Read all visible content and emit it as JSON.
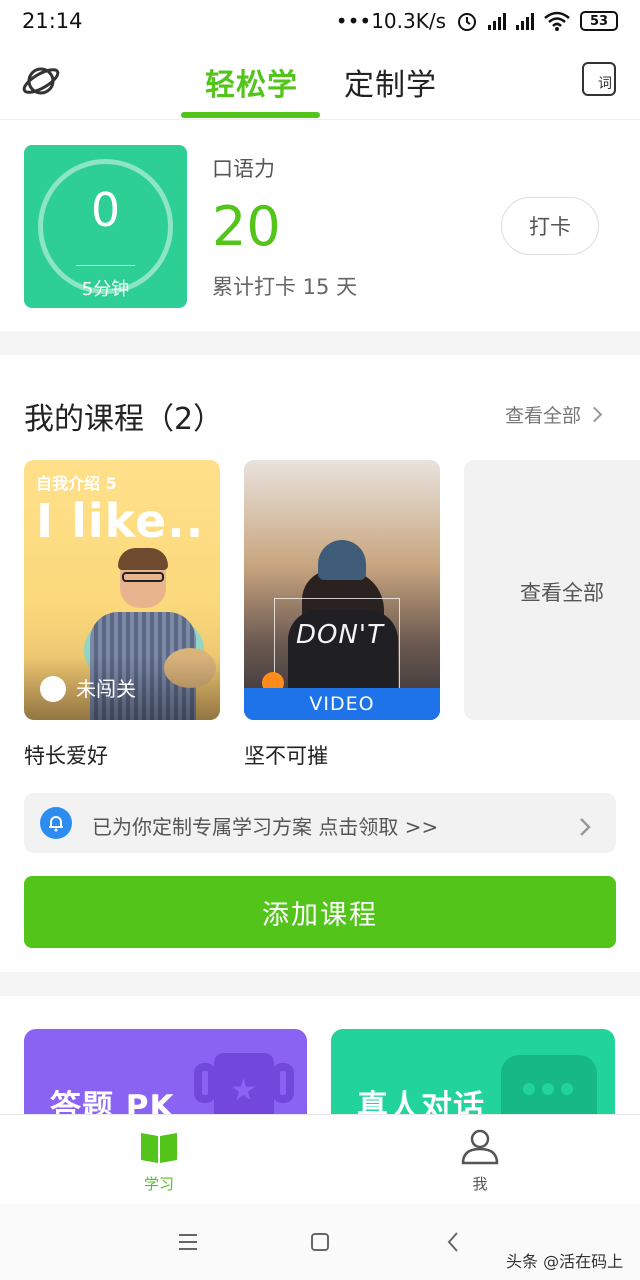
{
  "status_bar": {
    "time": "21:14",
    "network_speed": "•••10.3K/s",
    "battery": "53",
    "icons": [
      "alarm-icon",
      "hd-signal-icon",
      "signal-icon",
      "wifi-icon",
      "battery-icon"
    ]
  },
  "top_nav": {
    "tabs": [
      {
        "label": "轻松学",
        "active": true
      },
      {
        "label": "定制学",
        "active": false
      }
    ],
    "left_icon": "planet-icon",
    "right_icon_text": "词"
  },
  "checkin": {
    "timer_value": "0",
    "timer_unit": "5分钟",
    "skill_label": "口语力",
    "skill_score": "20",
    "streak_text": "累计打卡 15 天",
    "button_label": "打卡"
  },
  "courses": {
    "section_title": "我的课程（2）",
    "view_all_label": "查看全部",
    "cards": [
      {
        "tag": "自我介绍 5",
        "cover_text": "I like..",
        "status": "未闯关",
        "title": "特长爱好"
      },
      {
        "cover_text": "DON'T",
        "badge": "VIDEO",
        "title": "坚不可摧"
      }
    ],
    "more_card_label": "查看全部"
  },
  "promo": {
    "text": "已为你定制专属学习方案 点击领取 >>"
  },
  "add_course_label": "添加课程",
  "features": [
    {
      "title": "答题 PK",
      "color": "#8a63f2"
    },
    {
      "title": "真人对话",
      "color": "#22d39c"
    }
  ],
  "bottom_nav": {
    "items": [
      {
        "label": "学习",
        "icon": "book-icon",
        "active": true
      },
      {
        "label": "我",
        "icon": "person-icon",
        "active": false
      }
    ]
  },
  "watermark": "头条 @活在码上",
  "colors": {
    "accent": "#52c41a",
    "timer_tile": "#2ecf94",
    "video_badge": "#1e73e8",
    "bell": "#2d8cf0"
  }
}
